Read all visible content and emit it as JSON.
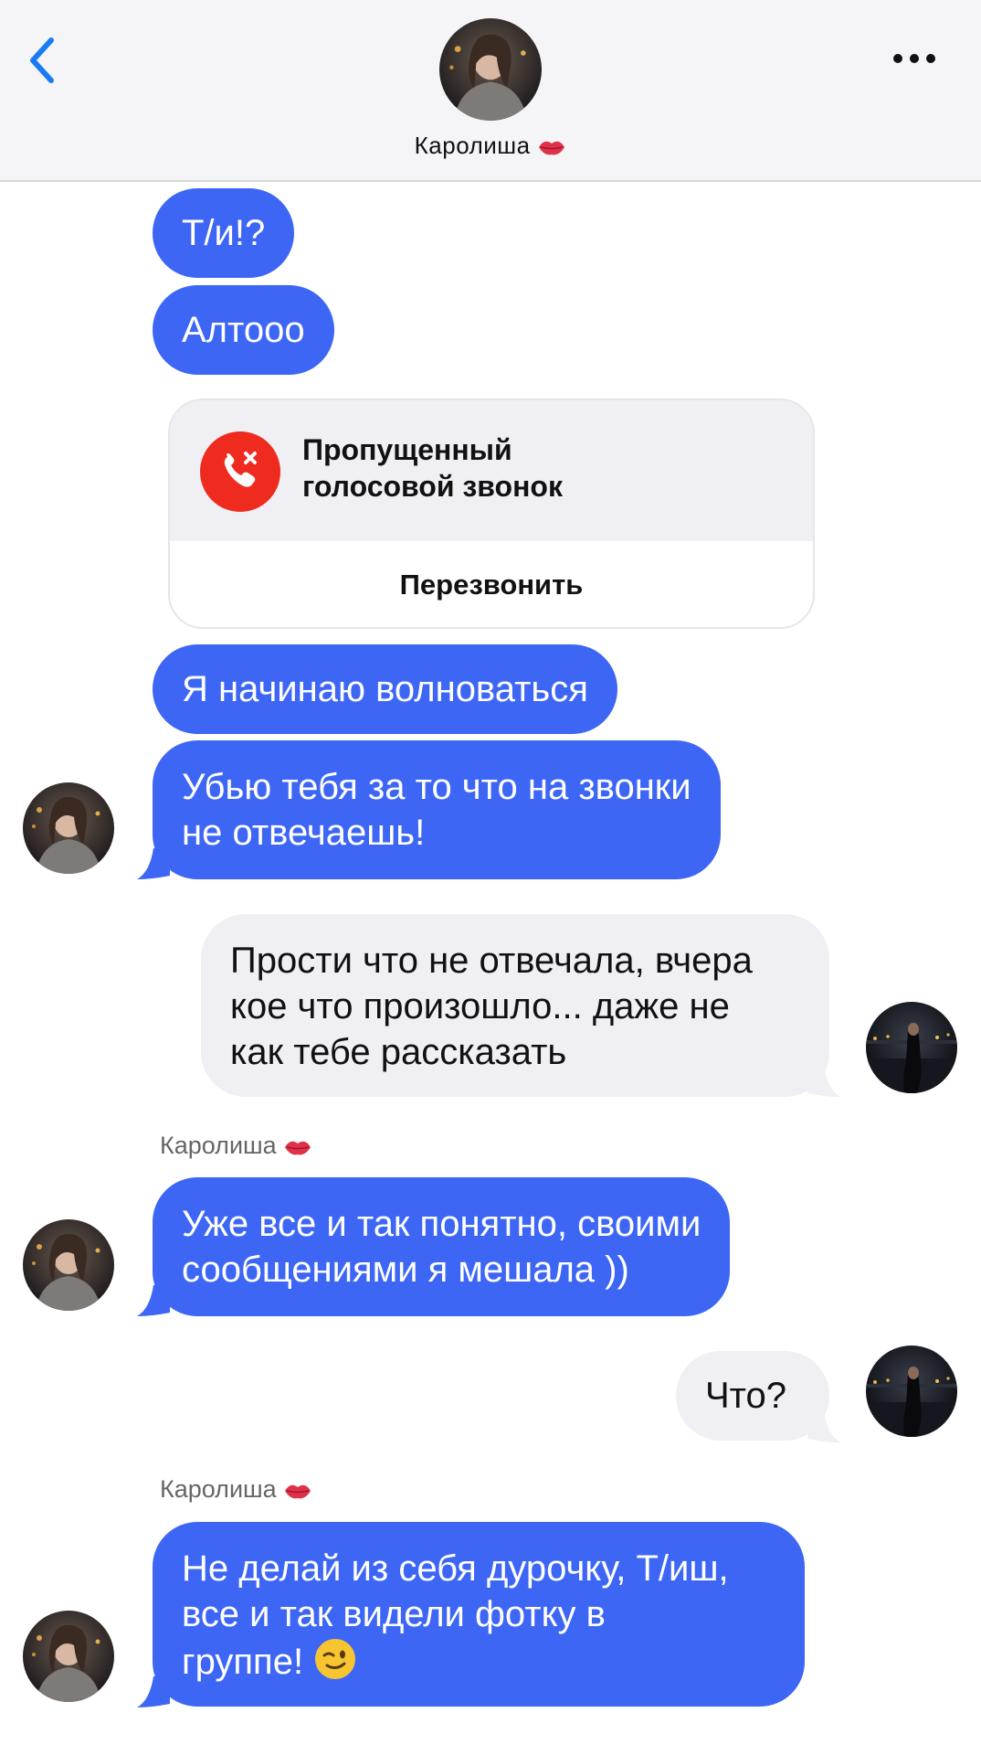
{
  "header": {
    "contact_name": "Каролиша",
    "back_icon": "chevron-left-icon",
    "more_icon": "more-horizontal-icon",
    "accent_color": "#1a7cf5"
  },
  "messages": [
    {
      "side": "in",
      "text": "Т/и!?"
    },
    {
      "side": "in",
      "text": "Алтооо"
    },
    {
      "side": "in",
      "text": "Я начинаю волноваться"
    },
    {
      "side": "in",
      "line1": "Убью тебя за то что на звонки",
      "line2": "не отвечаешь!"
    },
    {
      "side": "out",
      "line1": "Прости что не отвечала, вчера",
      "line2": "кое что произошло... даже не",
      "line3": "как тебе рассказать"
    },
    {
      "side": "in",
      "sender": "Каролиша",
      "line1": "Уже все и так понятно, своими",
      "line2": "сообщениями я мешала ))"
    },
    {
      "side": "out",
      "text": "Что?"
    },
    {
      "side": "in",
      "sender": "Каролиша",
      "line1": "Не делай из себя дурочку, Т/иш,",
      "line2": "все и так видели фотку в",
      "line3": "группе!"
    }
  ],
  "missed_call": {
    "title_line1": "Пропущенный",
    "title_line2": "голосовой звонок",
    "action_label": "Перезвонить",
    "icon": "missed-call-icon",
    "icon_color": "#ef2b20"
  },
  "colors": {
    "incoming_bubble": "#3d66f5",
    "outgoing_bubble": "#f0eff4"
  }
}
